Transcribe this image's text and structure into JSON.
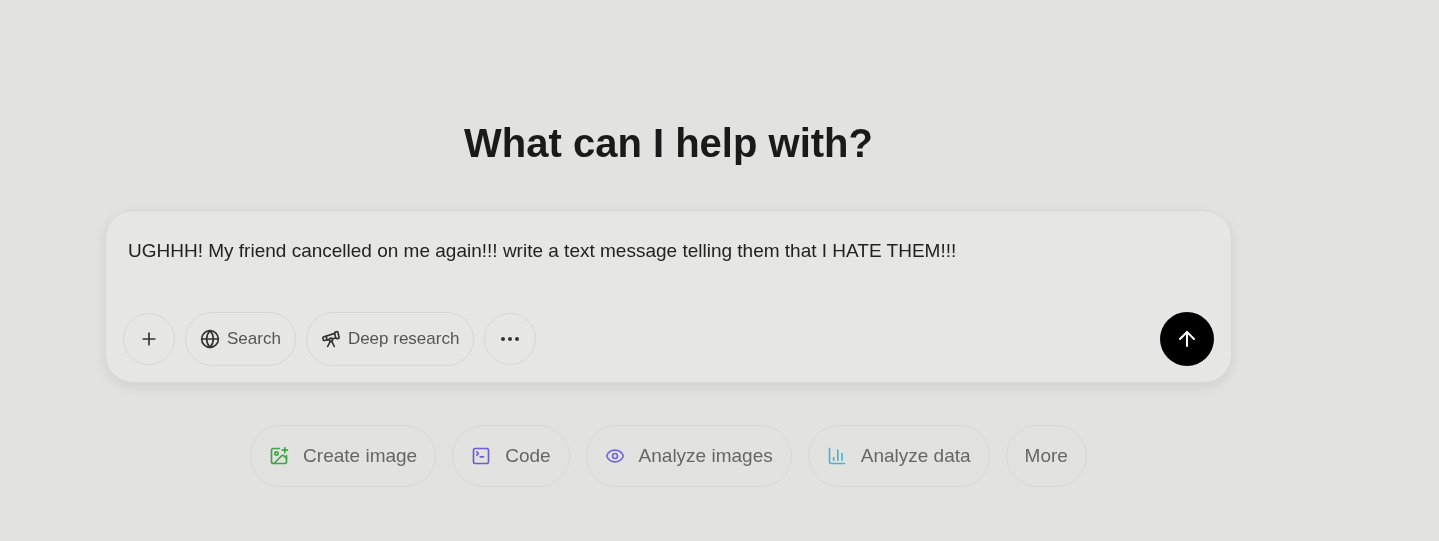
{
  "heading": "What can I help with?",
  "composer": {
    "value": "UGHHH! My friend cancelled on me again!!! write a text message telling them that I HATE THEM!!!",
    "tools": [
      {
        "kind": "plus"
      },
      {
        "kind": "search",
        "label": "Search"
      },
      {
        "kind": "research",
        "label": "Deep research"
      },
      {
        "kind": "more"
      }
    ]
  },
  "suggestions": [
    {
      "kind": "image",
      "label": "Create image"
    },
    {
      "kind": "code",
      "label": "Code"
    },
    {
      "kind": "eye",
      "label": "Analyze images"
    },
    {
      "kind": "data",
      "label": "Analyze data"
    },
    {
      "kind": "none",
      "label": "More"
    }
  ]
}
